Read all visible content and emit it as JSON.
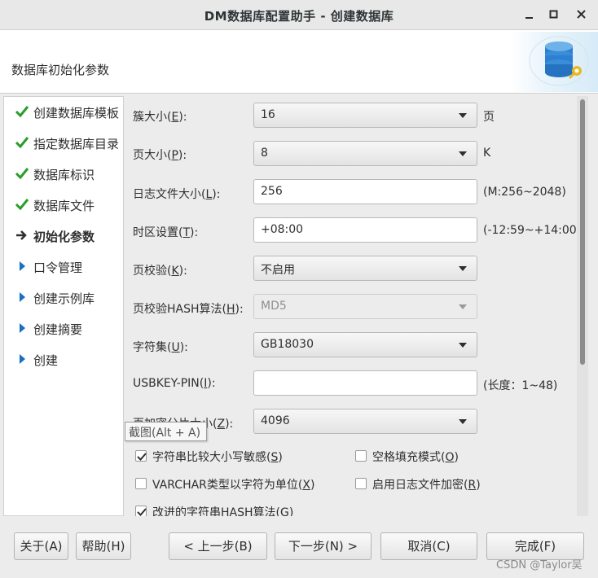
{
  "window": {
    "title": "DM数据库配置助手 - 创建数据库"
  },
  "header": {
    "title": "数据库初始化参数"
  },
  "steps": [
    {
      "label": "创建数据库模板",
      "state": "done"
    },
    {
      "label": "指定数据库目录",
      "state": "done"
    },
    {
      "label": "数据库标识",
      "state": "done"
    },
    {
      "label": "数据库文件",
      "state": "done"
    },
    {
      "label": "初始化参数",
      "state": "current"
    },
    {
      "label": "口令管理",
      "state": "pending"
    },
    {
      "label": "创建示例库",
      "state": "pending"
    },
    {
      "label": "创建摘要",
      "state": "pending"
    },
    {
      "label": "创建",
      "state": "pending"
    }
  ],
  "form": {
    "extent_size": {
      "label": "簇大小(",
      "mnemonic": "E",
      "label_end": "):",
      "value": "16",
      "unit": "页"
    },
    "page_size": {
      "label": "页大小(",
      "mnemonic": "P",
      "label_end": "):",
      "value": "8",
      "unit": "K"
    },
    "log_size": {
      "label": "日志文件大小(",
      "mnemonic": "L",
      "label_end": "):",
      "value": "256",
      "hint": "(M:256~2048)"
    },
    "time_zone": {
      "label": "时区设置(",
      "mnemonic": "T",
      "label_end": "):",
      "value": "+08:00",
      "hint": "(-12:59~+14:00)"
    },
    "page_check": {
      "label": "页校验(",
      "mnemonic": "K",
      "label_end": "):",
      "value": "不启用"
    },
    "page_check_hash": {
      "label": "页校验HASH算法(",
      "mnemonic": "H",
      "label_end": "):",
      "value": "MD5"
    },
    "charset": {
      "label": "字符集(",
      "mnemonic": "U",
      "label_end": "):",
      "value": "GB18030"
    },
    "usbkey_pin": {
      "label": "USBKEY-PIN(",
      "mnemonic": "I",
      "label_end": "):",
      "value": "",
      "hint": "(长度：1~48)"
    },
    "page_enc_slice": {
      "label": "页加密分片大小(",
      "mnemonic": "Z",
      "label_end": "):",
      "value": "4096"
    },
    "checkboxes": {
      "case_sensitive": {
        "label": "字符串比较大小写敏感(",
        "mnemonic": "S",
        "label_end": ")",
        "checked": true
      },
      "blank_pad": {
        "label": "空格填充模式(",
        "mnemonic": "O",
        "label_end": ")",
        "checked": false
      },
      "varchar_char": {
        "label": "VARCHAR类型以字符为单位(",
        "mnemonic": "X",
        "label_end": ")",
        "checked": false
      },
      "log_encrypt": {
        "label": "启用日志文件加密(",
        "mnemonic": "R",
        "label_end": ")",
        "checked": false
      },
      "improved_hash": {
        "label": "改进的字符串HASH算法(",
        "mnemonic": "G",
        "label_end": ")",
        "checked": true
      }
    }
  },
  "tooltip": {
    "text": "截图(Alt + A)"
  },
  "buttons": {
    "about": "关于(A)",
    "help": "帮助(H)",
    "prev": "< 上一步(B)",
    "next": "下一步(N) >",
    "cancel": "取消(C)",
    "finish": "完成(F)"
  },
  "watermark": "CSDN @Taylor吴",
  "colors": {
    "check": "#2a9d2a",
    "arrow": "#1a6fc4",
    "accent_blue": "#2d7fd1"
  }
}
